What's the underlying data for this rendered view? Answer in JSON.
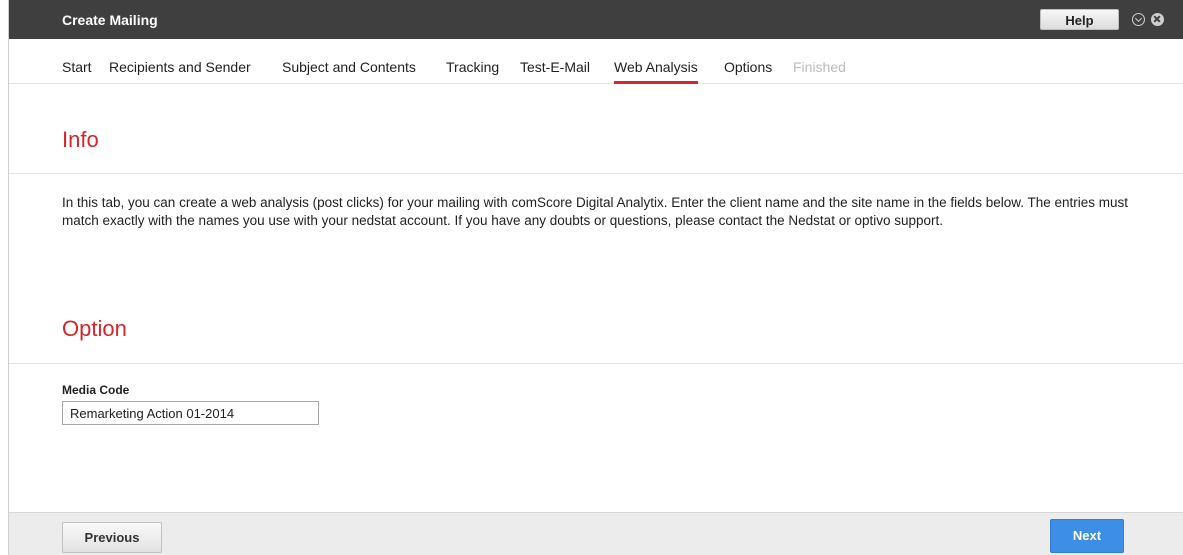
{
  "window": {
    "title": "Create Mailing",
    "help_label": "Help"
  },
  "tabs": [
    {
      "label": "Start",
      "state": "normal"
    },
    {
      "label": "Recipients and Sender",
      "state": "normal"
    },
    {
      "label": "Subject and Contents",
      "state": "normal"
    },
    {
      "label": "Tracking",
      "state": "normal"
    },
    {
      "label": "Test-E-Mail",
      "state": "normal"
    },
    {
      "label": "Web Analysis",
      "state": "active"
    },
    {
      "label": "Options",
      "state": "normal"
    },
    {
      "label": "Finished",
      "state": "disabled"
    }
  ],
  "info": {
    "heading": "Info",
    "text": "In this tab, you can create a web analysis (post clicks) for your mailing with comScore Digital Analytix. Enter the client name and the site name in the fields below. The entries must match exactly with the names you use with your nedstat account. If you have any doubts or questions, please contact the Nedstat or optivo support."
  },
  "option": {
    "heading": "Option",
    "media_code_label": "Media Code",
    "media_code_value": "Remarketing Action 01-2014"
  },
  "footer": {
    "previous_label": "Previous",
    "next_label": "Next"
  },
  "colors": {
    "accent_red": "#d6262b",
    "titlebar": "#3f3f3f",
    "primary_button": "#3d8ee6"
  },
  "icons": {
    "minimize": "chevron-circle-icon",
    "close": "close-circle-icon"
  }
}
